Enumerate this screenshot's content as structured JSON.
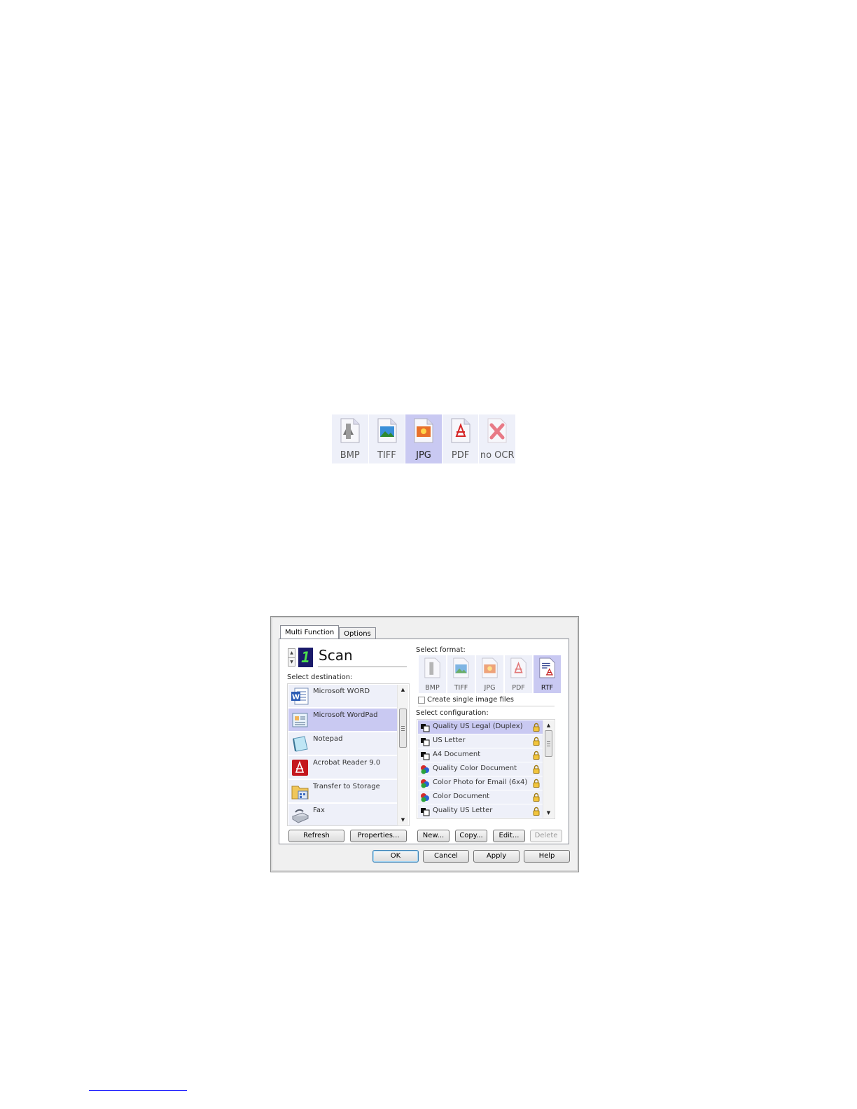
{
  "format_strip": {
    "items": [
      {
        "label": "BMP",
        "icon": "bmp-icon",
        "selected": false
      },
      {
        "label": "TIFF",
        "icon": "tiff-icon",
        "selected": false
      },
      {
        "label": "JPG",
        "icon": "jpg-icon",
        "selected": true
      },
      {
        "label": "PDF",
        "icon": "pdf-icon",
        "selected": false
      },
      {
        "label": "no OCR",
        "icon": "no-ocr-icon",
        "selected": false
      }
    ]
  },
  "dialog": {
    "tabs": [
      {
        "label": "Multi Function",
        "active": true
      },
      {
        "label": "Options",
        "active": false
      }
    ],
    "event": {
      "number": "1",
      "name": "Scan"
    },
    "destination": {
      "label": "Select destination:",
      "items": [
        {
          "label": "Microsoft WORD",
          "icon": "word-icon",
          "selected": false
        },
        {
          "label": "Microsoft WordPad",
          "icon": "wordpad-icon",
          "selected": true
        },
        {
          "label": "Notepad",
          "icon": "notepad-icon",
          "selected": false
        },
        {
          "label": "Acrobat Reader 9.0",
          "icon": "acrobat-icon",
          "selected": false
        },
        {
          "label": "Transfer to Storage",
          "icon": "storage-folder-icon",
          "selected": false
        },
        {
          "label": "Fax",
          "icon": "fax-icon",
          "selected": false
        }
      ],
      "refresh_label": "Refresh",
      "properties_label": "Properties..."
    },
    "format": {
      "label": "Select format:",
      "items": [
        {
          "label": "BMP",
          "icon": "bmp-icon",
          "selected": false
        },
        {
          "label": "TIFF",
          "icon": "tiff-icon",
          "selected": false
        },
        {
          "label": "JPG",
          "icon": "jpg-icon",
          "selected": false
        },
        {
          "label": "PDF",
          "icon": "pdf-icon",
          "selected": false
        },
        {
          "label": "RTF",
          "icon": "rtf-icon",
          "selected": true
        }
      ],
      "single_image_label": "Create single image files",
      "single_image_checked": false
    },
    "configuration": {
      "label": "Select configuration:",
      "items": [
        {
          "label": "Quality US Legal (Duplex)",
          "icon": "bw-config-icon",
          "selected": true
        },
        {
          "label": "US Letter",
          "icon": "bw-config-icon",
          "selected": false
        },
        {
          "label": "A4 Document",
          "icon": "bw-config-icon",
          "selected": false
        },
        {
          "label": "Quality Color Document",
          "icon": "color-config-icon",
          "selected": false
        },
        {
          "label": "Color Photo for Email (6x4)",
          "icon": "color-config-icon",
          "selected": false
        },
        {
          "label": "Color Document",
          "icon": "color-config-icon",
          "selected": false
        },
        {
          "label": "Quality US Letter",
          "icon": "bw-config-icon",
          "selected": false
        }
      ],
      "new_label": "New...",
      "copy_label": "Copy...",
      "edit_label": "Edit...",
      "delete_label": "Delete"
    },
    "buttons": {
      "ok": "OK",
      "cancel": "Cancel",
      "apply": "Apply",
      "help": "Help"
    }
  },
  "colors": {
    "selection": "#c9c9f2",
    "item_bg": "#eef0f9",
    "led_bg": "#1a1a6a",
    "led_digit": "#4ce14c"
  }
}
